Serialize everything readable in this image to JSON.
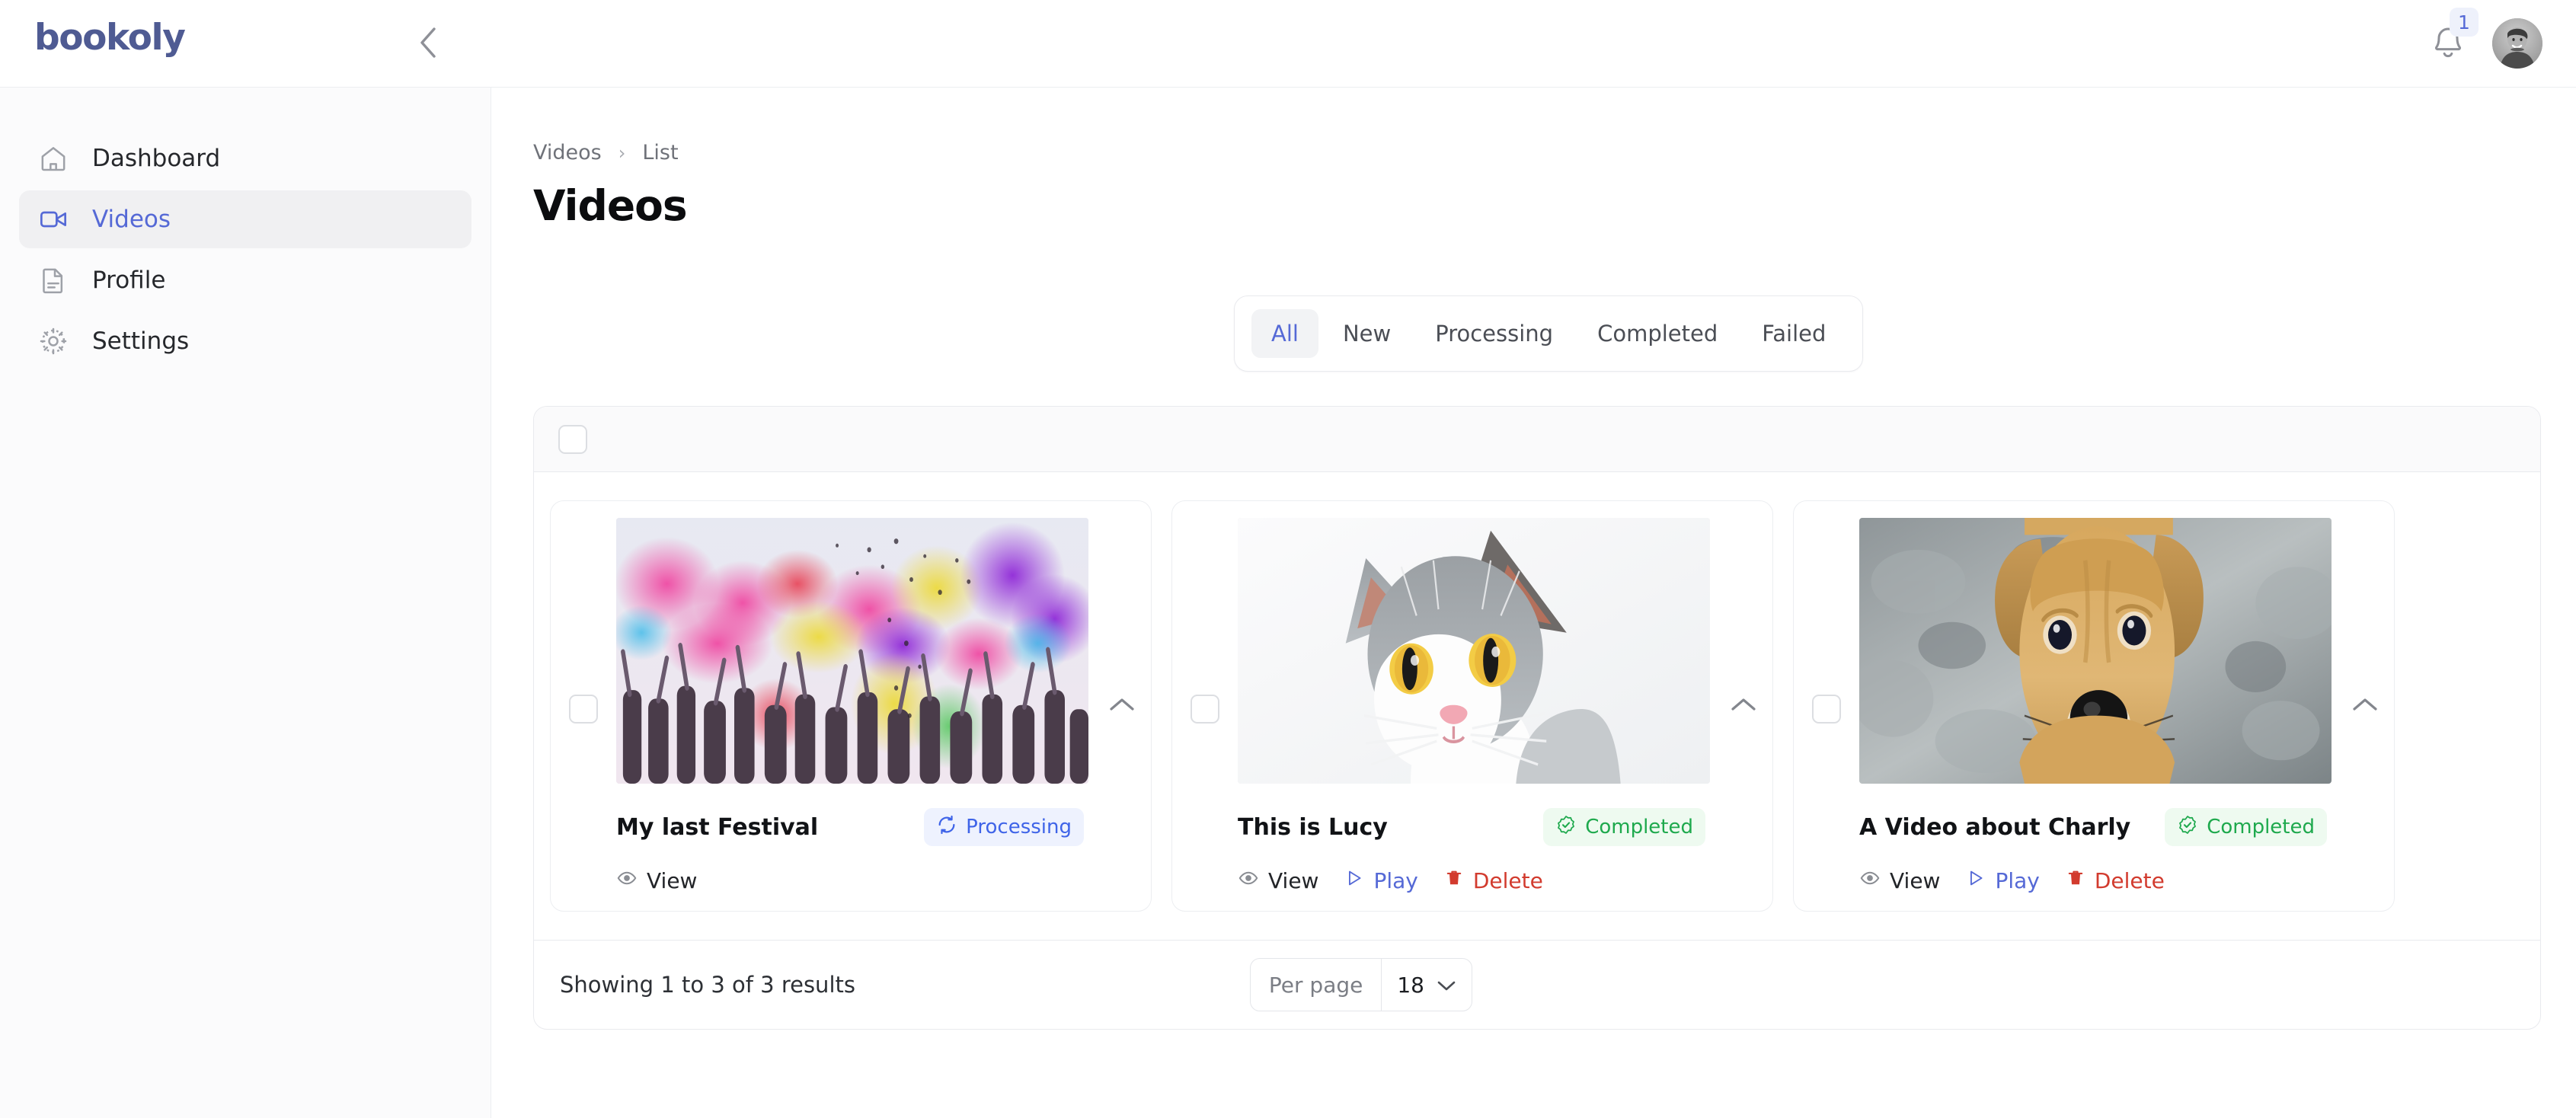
{
  "brand": {
    "name": "bookoly"
  },
  "topbar": {
    "collapse_icon": "chevron-left-icon",
    "notifications": {
      "icon": "bell-icon",
      "count": "1"
    },
    "avatar": {
      "icon": "user-avatar"
    }
  },
  "sidebar": {
    "items": [
      {
        "label": "Dashboard",
        "icon": "home-icon",
        "active": false
      },
      {
        "label": "Videos",
        "icon": "video-icon",
        "active": true
      },
      {
        "label": "Profile",
        "icon": "document-icon",
        "active": false
      },
      {
        "label": "Settings",
        "icon": "gear-icon",
        "active": false
      }
    ]
  },
  "breadcrumb": {
    "items": [
      "Videos",
      "List"
    ],
    "separator": "›"
  },
  "page": {
    "title": "Videos"
  },
  "tabs": [
    {
      "label": "All",
      "active": true
    },
    {
      "label": "New",
      "active": false
    },
    {
      "label": "Processing",
      "active": false
    },
    {
      "label": "Completed",
      "active": false
    },
    {
      "label": "Failed",
      "active": false
    }
  ],
  "list": {
    "select_all": {
      "checked": false
    },
    "cards": [
      {
        "title": "My last Festival",
        "status": {
          "label": "Processing",
          "kind": "processing",
          "icon": "refresh-icon"
        },
        "thumb": "holi-festival-photo",
        "actions": [
          {
            "label": "View",
            "kind": "view",
            "icon": "eye-icon"
          }
        ],
        "expand_icon": "chevron-up-icon"
      },
      {
        "title": "This is Lucy",
        "status": {
          "label": "Completed",
          "kind": "completed",
          "icon": "check-badge-icon"
        },
        "thumb": "gray-white-cat-photo",
        "actions": [
          {
            "label": "View",
            "kind": "view",
            "icon": "eye-icon"
          },
          {
            "label": "Play",
            "kind": "play",
            "icon": "play-icon"
          },
          {
            "label": "Delete",
            "kind": "delete",
            "icon": "trash-icon"
          }
        ],
        "expand_icon": "chevron-up-icon"
      },
      {
        "title": "A Video about Charly",
        "status": {
          "label": "Completed",
          "kind": "completed",
          "icon": "check-badge-icon"
        },
        "thumb": "tan-dog-photo",
        "actions": [
          {
            "label": "View",
            "kind": "view",
            "icon": "eye-icon"
          },
          {
            "label": "Play",
            "kind": "play",
            "icon": "play-icon"
          },
          {
            "label": "Delete",
            "kind": "delete",
            "icon": "trash-icon"
          }
        ],
        "expand_icon": "chevron-up-icon"
      }
    ]
  },
  "footer": {
    "results_text": "Showing 1 to 3 of 3 results",
    "per_page": {
      "label": "Per page",
      "value": "18",
      "icon": "chevron-down-icon"
    }
  },
  "colors": {
    "brand": "#4f5b93",
    "accent": "#5569d6",
    "processing_text": "#3f64e8",
    "processing_bg": "#eef2fe",
    "completed_text": "#1ea94d",
    "completed_bg": "#eefaf0",
    "danger": "#d23b2e"
  }
}
